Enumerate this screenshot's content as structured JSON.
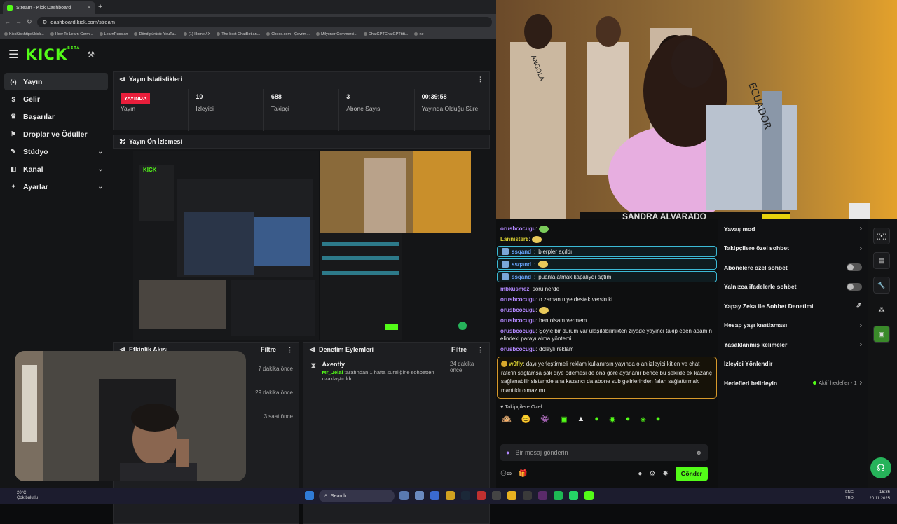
{
  "browser": {
    "tab_title": "Stream - Kick Dashboard",
    "url": "dashboard.kick.com/stream",
    "bookmarks": [
      "KickKickhttps//kick...",
      "How To Learn Germ...",
      "LearnRussian",
      "Döndgtürücü: YouTu...",
      "(1) Home / X",
      "The best ChatBot an...",
      "Cheos.com - Çevrim...",
      "Milyoner Commerci...",
      "ChatGPTChatGPTtttt...",
      "ne"
    ]
  },
  "sidebar": {
    "logo": "KICK",
    "logo_beta": "BETA",
    "items": [
      {
        "label": "Yayın",
        "icon": "broadcast-icon"
      },
      {
        "label": "Gelir",
        "icon": "money-icon"
      },
      {
        "label": "Başarılar",
        "icon": "trophy-icon"
      },
      {
        "label": "Droplar ve Ödüller",
        "icon": "gift-icon"
      },
      {
        "label": "Stüdyo",
        "icon": "brush-icon"
      },
      {
        "label": "Kanal",
        "icon": "channel-icon"
      },
      {
        "label": "Ayarlar",
        "icon": "gear-icon"
      }
    ]
  },
  "stats": {
    "title": "Yayın İstatistikleri",
    "live_badge": "YAYINDA",
    "items": [
      {
        "value": "",
        "label": "Yayın"
      },
      {
        "value": "10",
        "label": "İzleyici"
      },
      {
        "value": "688",
        "label": "Takipçi"
      },
      {
        "value": "3",
        "label": "Abone Sayısı"
      },
      {
        "value": "00:39:58",
        "label": "Yayında Olduğu Süre"
      }
    ]
  },
  "preview": {
    "title": "Yayın Ön İzlemesi"
  },
  "activity": {
    "title": "Etkinlik Akışı",
    "filter": "Filtre",
    "times": [
      "7 dakika önce",
      "29 dakika önce",
      "3 saat önce"
    ]
  },
  "moderation": {
    "title": "Denetim Eylemleri",
    "filter": "Filtre",
    "item": {
      "name": "Axently",
      "user": "Mr_Jelal",
      "text": "tarafından 1 hafta süreliğine sohbetten uzaklaştırıldı",
      "time": "24 dakika önce"
    }
  },
  "video": {
    "nameplate": "SANDRA ALVARADO"
  },
  "chat": {
    "messages": [
      {
        "user": "orusbcocugu",
        "text": "",
        "color": "purple",
        "emote": true
      },
      {
        "user": "Lannister8",
        "text": "",
        "color": "yellow",
        "emote": true
      },
      {
        "user": "ssqand",
        "text": "bierpler açıldı",
        "color": "blue",
        "highlight": true
      },
      {
        "user": "ssqand",
        "text": "",
        "color": "blue",
        "highlight": true,
        "emote": true
      },
      {
        "user": "ssqand",
        "text": "puanla atmak kapalıydı açtım",
        "color": "blue",
        "highlight": true
      },
      {
        "user": "mbkusmez",
        "text": "soru nerde",
        "color": "purple"
      },
      {
        "user": "orusbcocugu",
        "text": "o zaman niye destek versin ki",
        "color": "purple"
      },
      {
        "user": "orusbcocugu",
        "text": "",
        "color": "purple",
        "emote": true
      },
      {
        "user": "orusbcocugu",
        "text": "ben olsam vermem",
        "color": "purple"
      },
      {
        "user": "orusbcocugu",
        "text": "Şöyle bir durum var ulaşılabilirlikten ziyade yayıncı takip eden adamın elindeki parayı alma yöntemi",
        "color": "purple"
      },
      {
        "user": "orusbcocugu",
        "text": "dolaylı reklam",
        "color": "purple"
      }
    ],
    "big_message": {
      "user": "w0fly",
      "text": "dayı yerleştirmeli reklam kullanırsın yayında o an izleyici kitlen ve chat rate'in sağlamsa şak diye ödemesi de ona göre ayarlanır bence bu şekilde ek kazanç sağlanabilir sistemde ana kazancı da abone sub gelirlerinden falan sağlattırmak mantıklı olmaz mı"
    },
    "subs_only": "Takipçilere Özel",
    "input_placeholder": "Bir mesaj gönderin",
    "send_label": "Gönder"
  },
  "settings": {
    "items": [
      {
        "label": "Yavaş mod",
        "kind": "chevron"
      },
      {
        "label": "Takipçilere özel sohbet",
        "kind": "chevron"
      },
      {
        "label": "Abonelere özel sohbet",
        "kind": "toggle"
      },
      {
        "label": "Yalnızca ifadelerle sohbet",
        "kind": "toggle"
      },
      {
        "label": "Yapay Zeka ile Sohbet Denetimi",
        "kind": "external"
      },
      {
        "label": "Hesap yaşı kısıtlaması",
        "kind": "chevron"
      },
      {
        "label": "Yasaklanmış kelimeler",
        "kind": "chevron"
      },
      {
        "label": "İzleyici Yönlendir",
        "kind": "none"
      },
      {
        "label": "Hedefleri belirleyin",
        "kind": "goal"
      }
    ],
    "active_goals": "Aktif hedefler - 1"
  },
  "taskbar": {
    "temp": "20°C",
    "weather": "Çok bulutlu",
    "search": "Search",
    "lang1": "ENG",
    "lang2": "TRQ",
    "time": "16:36",
    "date": "20.11.2025"
  },
  "colors": {
    "kick_green": "#53fc18",
    "live_red": "#e91e3b",
    "highlight_border": "#3cbad6",
    "alert_border": "#d89a2b"
  }
}
